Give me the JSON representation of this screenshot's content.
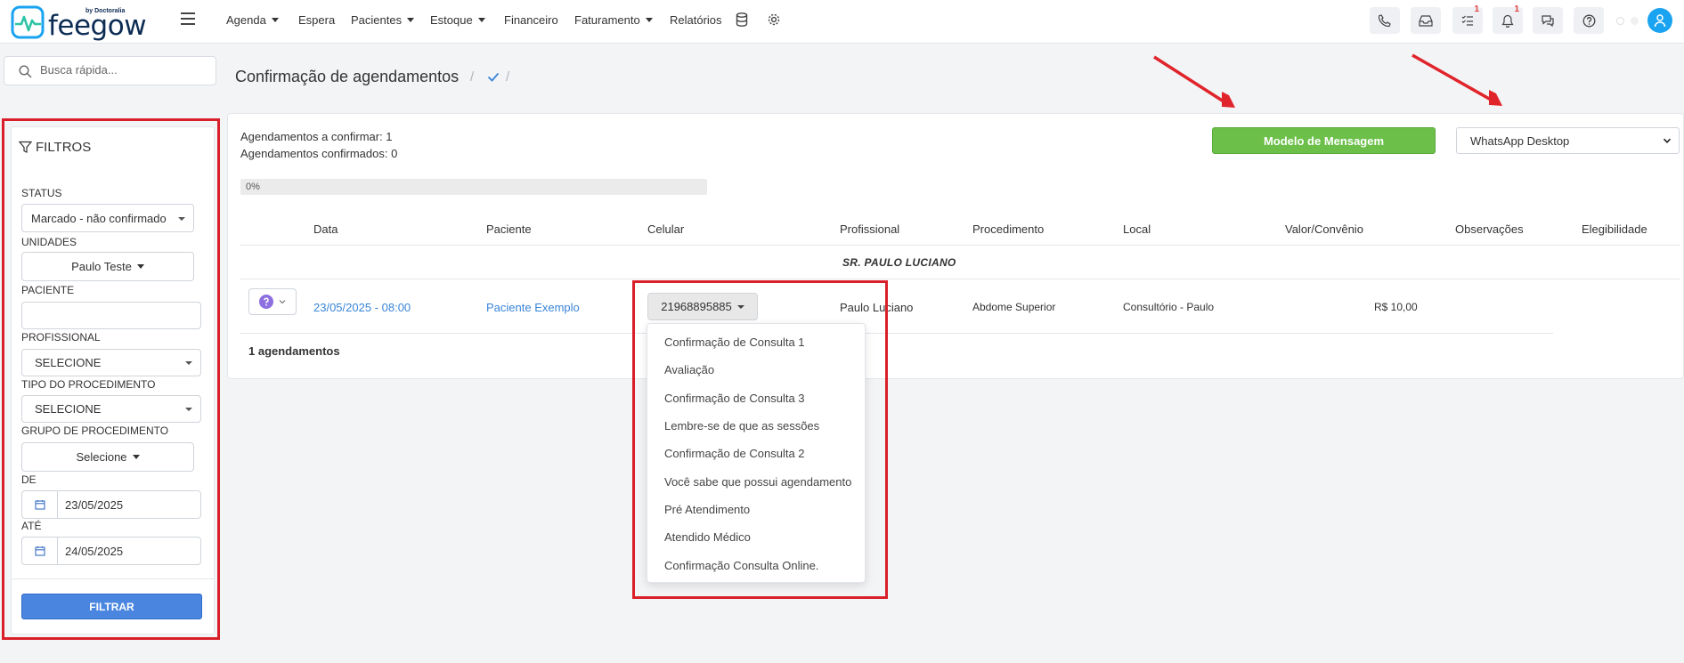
{
  "brand": {
    "name": "feegow",
    "byline": "by Doctoralia"
  },
  "nav": {
    "items": [
      {
        "label": "Agenda",
        "caret": true
      },
      {
        "label": "Espera",
        "caret": false
      },
      {
        "label": "Pacientes",
        "caret": true
      },
      {
        "label": "Estoque",
        "caret": true
      },
      {
        "label": "Financeiro",
        "caret": false
      },
      {
        "label": "Faturamento",
        "caret": true
      },
      {
        "label": "Relatórios",
        "caret": false
      }
    ],
    "icons": [
      "database-icon",
      "gear-icon"
    ],
    "toolbar": [
      {
        "icon": "phone-icon",
        "badge": ""
      },
      {
        "icon": "inbox-icon",
        "badge": ""
      },
      {
        "icon": "tasks-icon",
        "badge": "1"
      },
      {
        "icon": "bell-icon",
        "badge": "1"
      },
      {
        "icon": "chat-icon",
        "badge": ""
      },
      {
        "icon": "help-icon",
        "badge": ""
      }
    ]
  },
  "search": {
    "placeholder": "Busca rápida..."
  },
  "page": {
    "title": "Confirmação de agendamentos",
    "separator": "/"
  },
  "filters": {
    "title": "FILTROS",
    "status_label": "STATUS",
    "status_value": "Marcado - não confirmado",
    "unidades_label": "UNIDADES",
    "unidades_value": "Paulo Teste",
    "paciente_label": "PACIENTE",
    "paciente_value": "",
    "profissional_label": "PROFISSIONAL",
    "profissional_value": "SELECIONE",
    "tipo_label": "TIPO DO PROCEDIMENTO",
    "tipo_value": "SELECIONE",
    "grupo_label": "GRUPO DE PROCEDIMENTO",
    "grupo_value": "Selecione",
    "de_label": "DE",
    "de_value": "23/05/2025",
    "ate_label": "ATÉ",
    "ate_value": "24/05/2025",
    "submit_label": "FILTRAR"
  },
  "summary": {
    "to_confirm": "Agendamentos a confirmar: 1",
    "confirmed": "Agendamentos confirmados: 0",
    "progress_text": "0%",
    "progress_value": 0
  },
  "actions": {
    "modelo_label": "Modelo de Mensagem",
    "channel_value": "WhatsApp Desktop"
  },
  "table": {
    "headers": [
      "Data",
      "Paciente",
      "Celular",
      "Profissional",
      "Procedimento",
      "Local",
      "Valor/Convênio",
      "Observações",
      "Elegibilidade"
    ],
    "group_label": "SR. PAULO LUCIANO",
    "row": {
      "data": "23/05/2025 - 08:00",
      "paciente": "Paciente Exemplo",
      "celular": "21968895885",
      "profissional": "Paulo Luciano",
      "procedimento": "Abdome Superior",
      "local": "Consultório - Paulo",
      "valor": "R$ 10,00"
    },
    "footer": "1 agendamentos"
  },
  "message_templates": [
    "Confirmação de Consulta 1",
    "Avaliação",
    "Confirmação de Consulta 3",
    "Lembre-se de que as sessões",
    "Confirmação de Consulta 2",
    "Você sabe que possui agendamento",
    "Pré Atendimento",
    "Atendido Médico",
    "Confirmação Consulta Online."
  ],
  "colors": {
    "primary": "#4a86e0",
    "success": "#6cc04a",
    "annotation": "#d9202a",
    "link": "#3a85d8"
  }
}
